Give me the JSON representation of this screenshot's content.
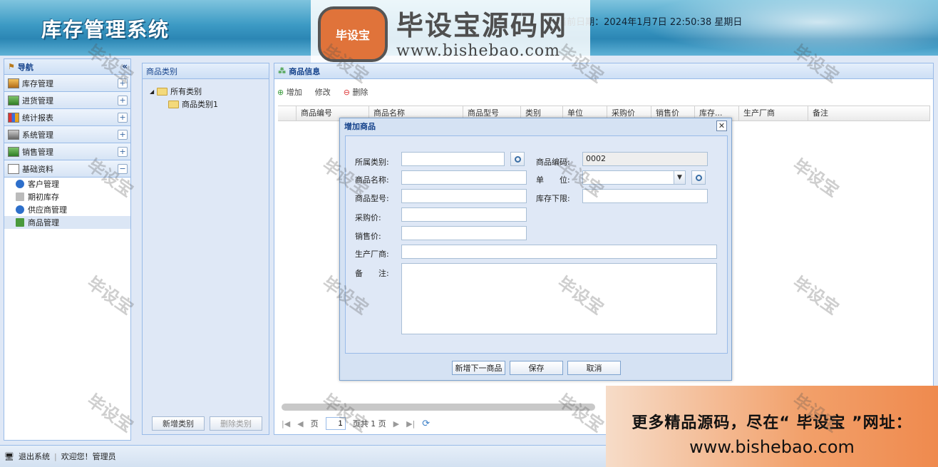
{
  "app": {
    "title": "库存管理系统",
    "datetime": "当前日期：2024年1月7日 22:50:38 星期日"
  },
  "logo": {
    "badge": "毕设宝",
    "main": "毕设宝源码网",
    "sub": "www.bishebao.com"
  },
  "nav": {
    "title": "导航",
    "sections": [
      "库存管理",
      "进货管理",
      "统计报表",
      "系统管理",
      "销售管理",
      "基础资料"
    ],
    "sub_items": [
      "客户管理",
      "期初库存",
      "供应商管理",
      "商品管理"
    ]
  },
  "category": {
    "title": "商品类别",
    "root": "所有类别",
    "child": "商品类别1",
    "add": "新增类别",
    "delete": "删除类别"
  },
  "goods": {
    "title": "商品信息",
    "toolbar": {
      "add": "增加",
      "edit": "修改",
      "delete": "删除"
    },
    "columns": [
      "商品编号",
      "商品名称",
      "商品型号",
      "类别",
      "单位",
      "采购价",
      "销售价",
      "库存...",
      "生产厂商",
      "备注"
    ],
    "pager": {
      "page": "页",
      "page_value": "1",
      "total": "页共 1 页"
    }
  },
  "dialog": {
    "title": "增加商品",
    "labels": {
      "category": "所属类别:",
      "code": "商品编码:",
      "name": "商品名称:",
      "unit": "单　　位:",
      "model": "商品型号:",
      "min_stock": "库存下限:",
      "purchase": "采购价:",
      "sale": "销售价:",
      "maker": "生产厂商:",
      "remark": "备　　注:"
    },
    "code_value": "0002",
    "buttons": {
      "next": "新增下一商品",
      "save": "保存",
      "cancel": "取消"
    }
  },
  "footer": {
    "logout": "退出系统",
    "welcome": "欢迎您！管理员"
  },
  "promo": {
    "line1": "更多精品源码，尽在“ 毕设宝 ”网址：",
    "line2": "www.bishebao.com"
  },
  "watermark": "毕设宝"
}
